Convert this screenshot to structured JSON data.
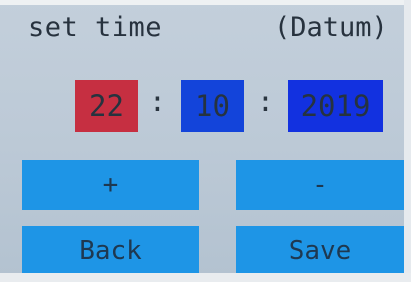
{
  "header": {
    "title": "set time",
    "subtitle": "(Datum)"
  },
  "date": {
    "day": "22",
    "separator_1": ":",
    "month": "10",
    "separator_2": ":",
    "year": "2019"
  },
  "buttons": {
    "increment_label": "+",
    "decrement_label": "-",
    "back_label": "Back",
    "save_label": "Save"
  },
  "colors": {
    "screen_background": "#bdcad7",
    "day_field": "#c62f41",
    "month_field": "#1344da",
    "year_field": "#1231e0",
    "button": "#1e95e6",
    "text": "#27323e"
  }
}
